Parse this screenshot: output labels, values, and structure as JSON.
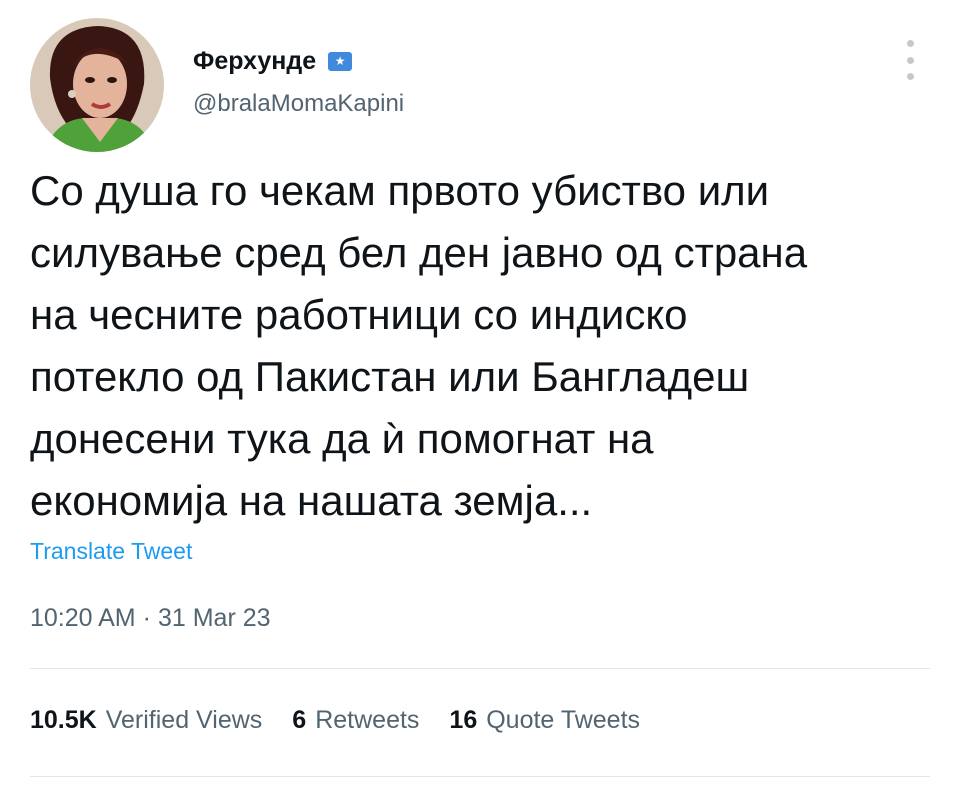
{
  "author": {
    "display_name": "Ферхунде",
    "handle": "@bralaMomaKapini",
    "badge_icon": "flag-icon",
    "badge_color": "#4189dd"
  },
  "tweet": {
    "text": "Со душа го чекам првото убиство или\nсилување сред бел ден јавно од страна\nна чесните работници со индиско\nпотекло од Пакистан или Бангладеш\nдонесени тука да ѝ помогнат на\nекономија на нашата земја...",
    "translate_label": "Translate Tweet",
    "time": "10:20 AM",
    "separator": "·",
    "date": "31 Mar 23"
  },
  "stats": {
    "views_count": "10.5K",
    "views_label": "Verified Views",
    "retweets_count": "6",
    "retweets_label": "Retweets",
    "quotes_count": "16",
    "quotes_label": "Quote Tweets"
  },
  "colors": {
    "link": "#1d9bf0",
    "secondary_text": "#536471",
    "primary_text": "#0f1419"
  }
}
